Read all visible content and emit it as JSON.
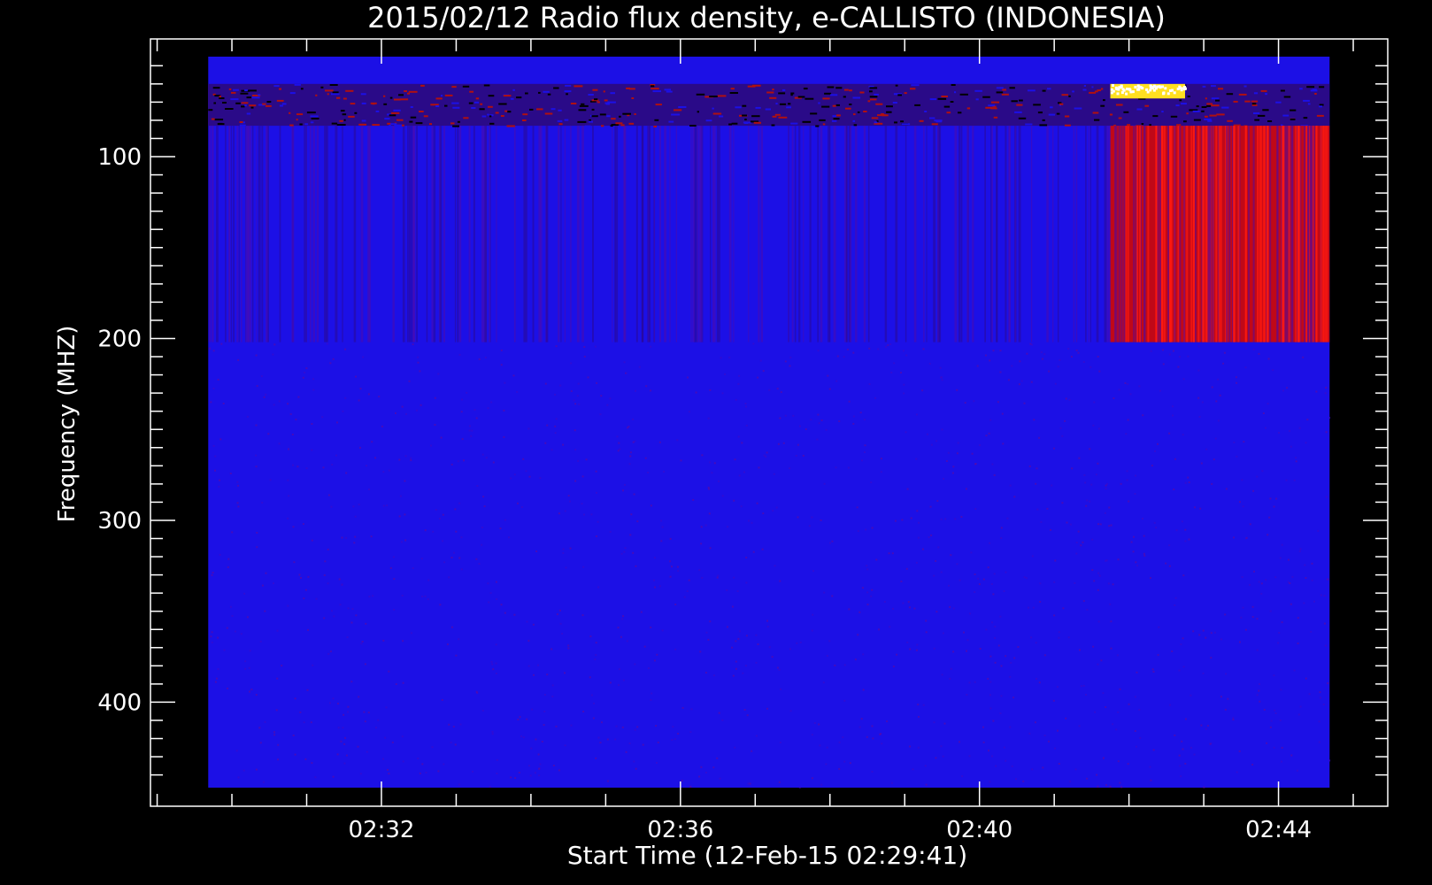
{
  "chart_data": {
    "type": "heatmap",
    "title": "2015/02/12  Radio flux density, e-CALLISTO (INDONESIA)",
    "xlabel": "Start Time (12-Feb-15 02:29:41)",
    "ylabel": "Frequency (MHZ)",
    "x_tick_labels": [
      "02:32",
      "02:36",
      "02:40",
      "02:44"
    ],
    "x_ticks_minutes_after_0229": [
      3,
      7,
      11,
      15
    ],
    "x_range_minutes_after_0229": [
      0.68,
      15.68
    ],
    "y_ticks": [
      100,
      200,
      300,
      400
    ],
    "y_range": [
      45,
      447
    ],
    "colormap": [
      "#000000",
      "#0000ff",
      "#ff0000",
      "#ffff00",
      "#ffffff"
    ],
    "features": [
      {
        "name": "background",
        "freq_range": [
          45,
          447
        ],
        "time_range": [
          "02:29:41",
          "02:44:41"
        ],
        "intensity": "low"
      },
      {
        "name": "rfi-band",
        "freq_range": [
          60,
          83
        ],
        "time_range": [
          "02:29:41",
          "02:44:41"
        ],
        "intensity": "mixed"
      },
      {
        "name": "burst-core",
        "freq_range": [
          60,
          68
        ],
        "time_range": [
          "02:41:45",
          "02:42:45"
        ],
        "intensity": "very high"
      },
      {
        "name": "burst-broadband",
        "freq_range": [
          83,
          202
        ],
        "time_range": [
          "02:41:45",
          "02:44:41"
        ],
        "intensity": "high"
      }
    ]
  }
}
